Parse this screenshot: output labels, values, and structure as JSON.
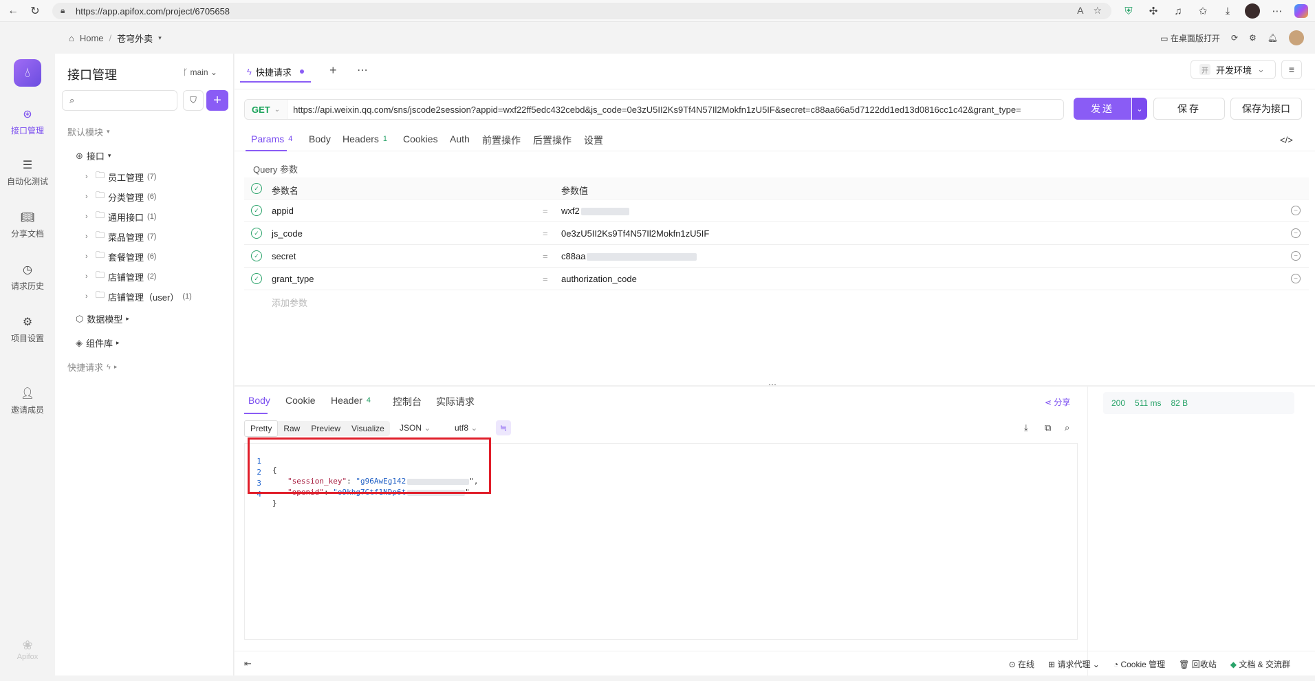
{
  "browser": {
    "url": "https://app.apifox.com/project/6705658",
    "ext_badge": "5"
  },
  "topbar": {
    "home": "Home",
    "project": "苍穹外卖",
    "open_desktop": "在桌面版打开"
  },
  "rail": {
    "items": [
      "接口管理",
      "自动化测试",
      "分享文档",
      "请求历史",
      "项目设置",
      "邀请成员"
    ],
    "brand": "Apifox"
  },
  "tree": {
    "title": "接口管理",
    "branch": "main",
    "default_module": "默认模块",
    "interfaces": "接口",
    "folders": [
      {
        "name": "员工管理",
        "count": "(7)"
      },
      {
        "name": "分类管理",
        "count": "(6)"
      },
      {
        "name": "通用接口",
        "count": "(1)"
      },
      {
        "name": "菜品管理",
        "count": "(7)"
      },
      {
        "name": "套餐管理",
        "count": "(6)"
      },
      {
        "name": "店铺管理",
        "count": "(2)"
      },
      {
        "name": "店铺管理（user）",
        "count": "(1)"
      }
    ],
    "data_models": "数据模型",
    "components": "组件库",
    "quick_request": "快捷请求"
  },
  "main": {
    "tab_label": "快捷请求",
    "env": "开发环境",
    "env_badge": "开",
    "method": "GET",
    "url": "https://api.weixin.qq.com/sns/jscode2session?appid=wxf22ff5edc432cebd&js_code=0e3zU5II2Ks9Tf4N57Il2Mokfn1zU5IF&secret=c88aa66a5d7122dd1ed13d0816cc1c42&grant_type=",
    "send": "发送",
    "save": "保存",
    "save_as": "保存为接口",
    "req_tabs": [
      {
        "label": "Params",
        "n": "4"
      },
      {
        "label": "Body",
        "n": ""
      },
      {
        "label": "Headers",
        "n": "1"
      },
      {
        "label": "Cookies",
        "n": ""
      },
      {
        "label": "Auth",
        "n": ""
      },
      {
        "label": "前置操作",
        "n": ""
      },
      {
        "label": "后置操作",
        "n": ""
      },
      {
        "label": "设置",
        "n": ""
      }
    ],
    "query_label": "Query 参数",
    "col_name": "参数名",
    "col_value": "参数值",
    "params": [
      {
        "name": "appid",
        "value": "wxf2"
      },
      {
        "name": "js_code",
        "value": "0e3zU5II2Ks9Tf4N57Il2Mokfn1zU5IF"
      },
      {
        "name": "secret",
        "value": "c88aa"
      },
      {
        "name": "grant_type",
        "value": "authorization_code"
      }
    ],
    "add_param": "添加参数"
  },
  "response": {
    "tabs": [
      {
        "label": "Body",
        "n": ""
      },
      {
        "label": "Cookie",
        "n": ""
      },
      {
        "label": "Header",
        "n": "4"
      },
      {
        "label": "控制台",
        "n": ""
      },
      {
        "label": "实际请求",
        "n": ""
      }
    ],
    "share": "分享",
    "status": "200",
    "time": "511 ms",
    "size": "82 B",
    "formats": [
      "Pretty",
      "Raw",
      "Preview",
      "Visualize"
    ],
    "format_type": "JSON",
    "encoding": "utf8",
    "lines": [
      {
        "n": "1",
        "text": "{"
      },
      {
        "n": "2",
        "key": "\"session_key\"",
        "val": "\"g96AwEg142"
      },
      {
        "n": "3",
        "key": "\"openid\"",
        "val": "\"o9khg7Gtf1NDp6t"
      },
      {
        "n": "4",
        "text": "}"
      }
    ]
  },
  "footer": {
    "items": [
      "在线",
      "请求代理",
      "Cookie 管理",
      "回收站",
      "文档 & 交流群"
    ]
  }
}
